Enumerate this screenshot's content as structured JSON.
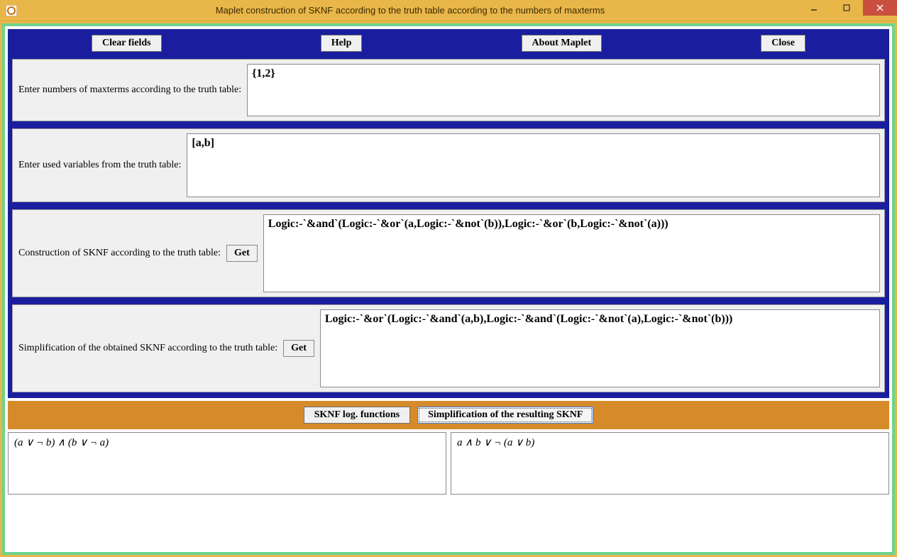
{
  "window": {
    "title": "Maplet construction of SKNF according to the truth table according to the numbers of maxterms"
  },
  "toolbar": {
    "clear_fields": "Clear fields",
    "help": "Help",
    "about": "About Maplet",
    "close": "Close"
  },
  "sections": {
    "maxterms": {
      "label": "Enter numbers of maxterms according to the truth table:",
      "value": "{1,2}"
    },
    "variables": {
      "label": "Enter used variables from the truth table:",
      "value": "[a,b]"
    },
    "construction": {
      "label": "Construction of SKNF according to the truth table:",
      "button": "Get",
      "value": "Logic:-`&and`(Logic:-`&or`(a,Logic:-`&not`(b)),Logic:-`&or`(b,Logic:-`&not`(a)))"
    },
    "simplification": {
      "label": "Simplification of the obtained SKNF according to the truth table:",
      "button": "Get",
      "value": "Logic:-`&or`(Logic:-`&and`(a,b),Logic:-`&and`(Logic:-`&not`(a),Logic:-`&not`(b)))"
    }
  },
  "bottom_buttons": {
    "sknf_log": "SKNF log. functions",
    "simplification_result": "Simplification of the resulting SKNF"
  },
  "results": {
    "left": "(a ∨ ¬ b) ∧ (b ∨ ¬ a)",
    "right": "a ∧ b ∨ ¬ (a ∨ b)"
  }
}
